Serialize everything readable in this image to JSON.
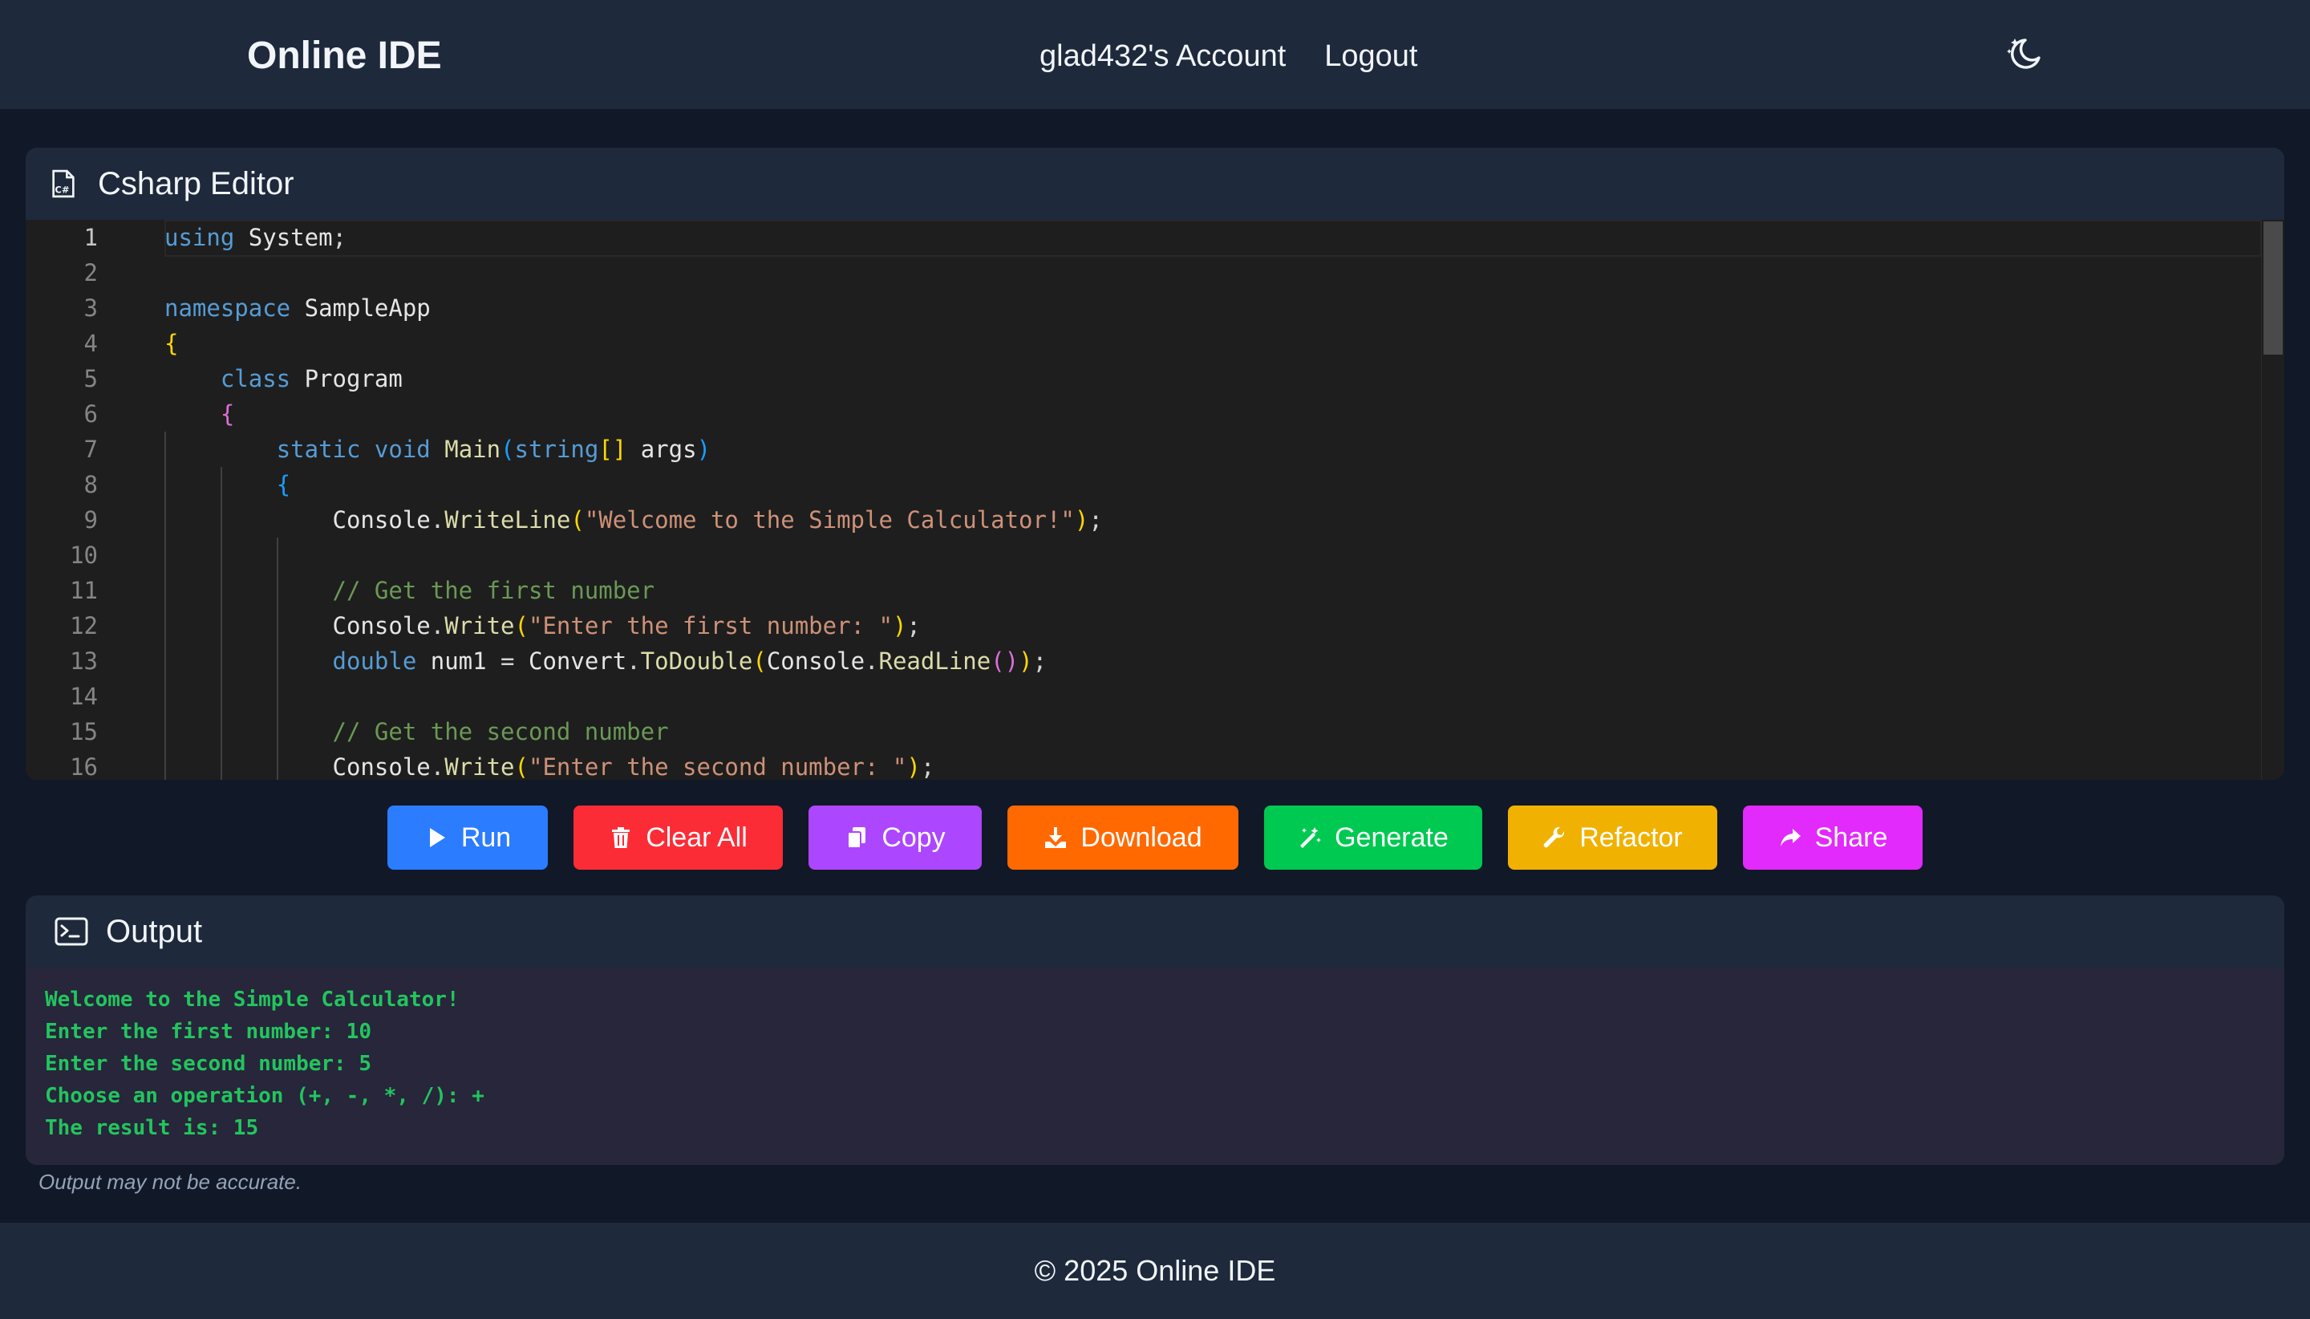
{
  "header": {
    "brand": "Online IDE",
    "account_link": "glad432's Account",
    "logout_link": "Logout",
    "theme_toggle_icon": "moon-stars-icon"
  },
  "editor": {
    "title": "Csharp Editor",
    "title_icon": "csharp-file-icon",
    "active_line": 1,
    "line_numbers": [
      "1",
      "2",
      "3",
      "4",
      "5",
      "6",
      "7",
      "8",
      "9",
      "10",
      "11",
      "12",
      "13",
      "14",
      "15",
      "16"
    ],
    "lines": [
      "using System;",
      "",
      "namespace SampleApp",
      "{",
      "    class Program",
      "    {",
      "        static void Main(string[] args)",
      "        {",
      "            Console.WriteLine(\"Welcome to the Simple Calculator!\");",
      "",
      "            // Get the first number",
      "            Console.Write(\"Enter the first number: \");",
      "            double num1 = Convert.ToDouble(Console.ReadLine());",
      "",
      "            // Get the second number",
      "            Console.Write(\"Enter the second number: \");"
    ]
  },
  "toolbar": {
    "run": "Run",
    "clear_all": "Clear All",
    "copy": "Copy",
    "download": "Download",
    "generate": "Generate",
    "refactor": "Refactor",
    "share": "Share"
  },
  "colors": {
    "run": "#2b7cff",
    "clear_all": "#fb2c36",
    "copy": "#ad46ff",
    "download": "#ff6900",
    "generate": "#00c951",
    "refactor": "#f0b100",
    "share": "#e12afb",
    "output_text": "#22c55e",
    "page_bg": "#111827",
    "card_bg": "#1e293b"
  },
  "output": {
    "title": "Output",
    "title_icon": "terminal-icon",
    "lines": [
      "Welcome to the Simple Calculator!",
      "Enter the first number: 10",
      "Enter the second number: 5",
      "Choose an operation (+, -, *, /): +",
      "The result is: 15"
    ],
    "disclaimer": "Output may not be accurate."
  },
  "footer": {
    "copyright": "© 2025 Online IDE"
  }
}
